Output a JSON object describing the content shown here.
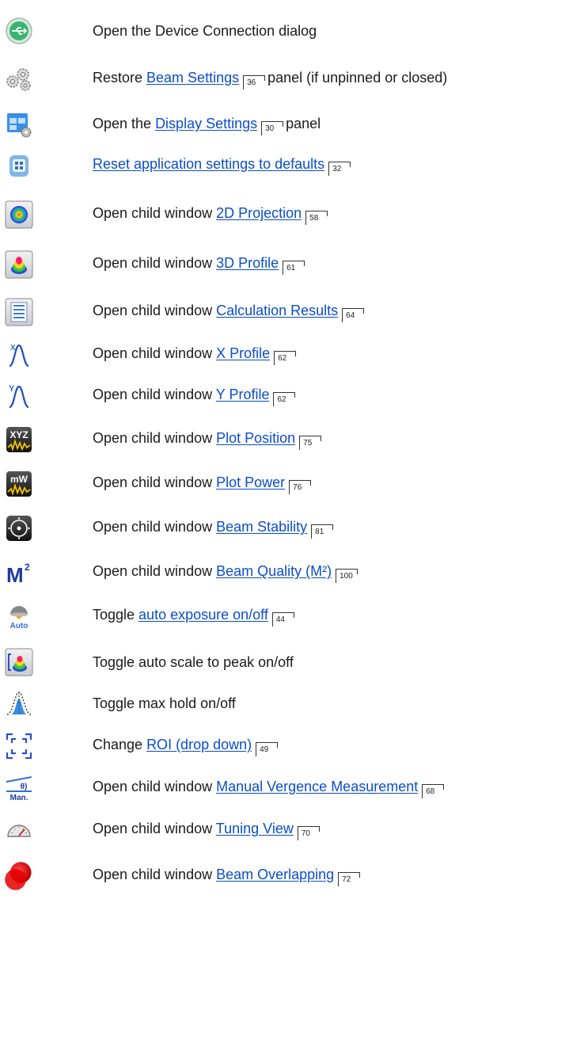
{
  "rows": [
    {
      "icon": "usb-connection-icon",
      "pre": "Open the Device Connection dialog",
      "link": "",
      "page": "",
      "post": ""
    },
    {
      "icon": "gears-icon",
      "pre": "Restore ",
      "link": "Beam Settings",
      "page": "36",
      "post": "panel (if unpinned or closed)"
    },
    {
      "icon": "display-settings-icon",
      "pre": "Open the ",
      "link": "Display Settings",
      "page": "30",
      "post": "panel"
    },
    {
      "icon": "reset-settings-icon",
      "pre": "",
      "link": "Reset application settings to defaults",
      "page": "32",
      "post": ""
    },
    {
      "icon": "2d-projection-icon",
      "pre": "Open child window ",
      "link": "2D Projection",
      "page": "58",
      "post": ""
    },
    {
      "icon": "3d-profile-icon",
      "pre": "Open child window ",
      "link": "3D Profile",
      "page": "61",
      "post": ""
    },
    {
      "icon": "calculation-results-icon",
      "pre": "Open child window ",
      "link": "Calculation Results",
      "page": "64",
      "post": ""
    },
    {
      "icon": "x-profile-icon",
      "pre": "Open child window ",
      "link": "X Profile",
      "page": "62",
      "post": ""
    },
    {
      "icon": "y-profile-icon",
      "pre": "Open child window ",
      "link": "Y Profile",
      "page": "62",
      "post": ""
    },
    {
      "icon": "plot-position-icon",
      "pre": "Open child window ",
      "link": "Plot Position",
      "page": "75",
      "post": ""
    },
    {
      "icon": "plot-power-icon",
      "pre": "Open child window ",
      "link": "Plot Power",
      "page": "76",
      "post": ""
    },
    {
      "icon": "beam-stability-icon",
      "pre": "Open child window ",
      "link": "Beam Stability",
      "page": "81",
      "post": ""
    },
    {
      "icon": "beam-quality-m2-icon",
      "pre": "Open child window ",
      "link": "Beam Quality (M²)",
      "page": "100",
      "post": ""
    },
    {
      "icon": "auto-exposure-icon",
      "pre": "Toggle ",
      "link": "auto exposure on/off",
      "page": "44",
      "post": ""
    },
    {
      "icon": "auto-scale-peak-icon",
      "pre": "Toggle auto scale to peak on/off",
      "link": "",
      "page": "",
      "post": ""
    },
    {
      "icon": "max-hold-icon",
      "pre": "Toggle max hold on/off",
      "link": "",
      "page": "",
      "post": ""
    },
    {
      "icon": "roi-icon",
      "pre": "Change ",
      "link": "ROI (drop down)",
      "page": "49",
      "post": ""
    },
    {
      "icon": "manual-vergence-icon",
      "pre": "Open child window ",
      "link": "Manual Vergence Measurement",
      "page": "68",
      "post": ""
    },
    {
      "icon": "tuning-view-icon",
      "pre": "Open child window ",
      "link": "Tuning View",
      "page": "70",
      "post": ""
    },
    {
      "icon": "beam-overlapping-icon",
      "pre": "Open child window ",
      "link": "Beam Overlapping",
      "page": "72",
      "post": ""
    }
  ],
  "icon_text": {
    "x_profile": "X",
    "y_profile": "Y",
    "plot_position": "XYZ",
    "plot_power": "mW",
    "m2_base": "M",
    "m2_sup": "2",
    "auto": "Auto",
    "vergence_top": "θ)",
    "vergence_bottom": "Man."
  },
  "colors": {
    "link": "#0a4dcc",
    "usb_green": "#3cb371",
    "text": "#1a1a1a"
  }
}
